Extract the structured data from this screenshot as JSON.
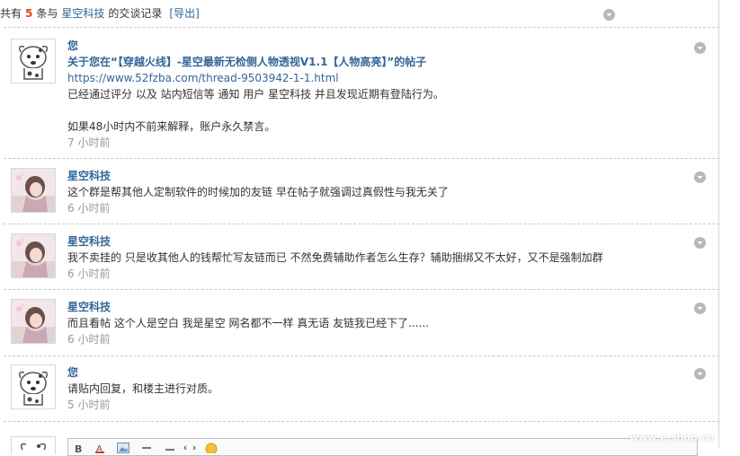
{
  "header": {
    "prefix": "共有",
    "count": "5",
    "middle": "条与",
    "partner": "星空科技",
    "suffix": "的交谈记录",
    "export_label": "[导出]"
  },
  "messages": [
    {
      "sender": "您",
      "avatar": "cartoon-dog-icon",
      "subject": "关于您在“【穿越火线】-星空最新无检侧人物透视V1.1【人物高亮】”的帖子",
      "url": "https://www.52fzba.com/thread-9503942-1-1.html",
      "line1": "已经通过评分 以及 站内短信等 通知 用户 星空科技 并且发现近期有登陆行为。",
      "line2": "如果48小时内不前来解释，账户永久禁言。",
      "time": "7 小时前"
    },
    {
      "sender": "星空科技",
      "avatar": "girl-photo-avatar",
      "text": "这个群是帮其他人定制软件的时候加的友链 早在帖子就强调过真假性与我无关了",
      "time": "6 小时前"
    },
    {
      "sender": "星空科技",
      "avatar": "girl-photo-avatar",
      "text": "我不卖挂的 只是收其他人的钱帮忙写友链而已 不然免费辅助作者怎么生存？辅助捆绑又不太好，又不是强制加群",
      "time": "6 小时前"
    },
    {
      "sender": "星空科技",
      "avatar": "girl-photo-avatar",
      "text": "而且看帖 这个人是空白 我是星空 网名都不一样 真无语 友链我已经下了......",
      "time": "6 小时前"
    },
    {
      "sender": "您",
      "avatar": "cartoon-dog-icon",
      "text": "请贴内回复，和楼主进行对质。",
      "time": "5 小时前"
    }
  ],
  "watermark": "www.e-shop.cn",
  "colors": {
    "link": "#336699",
    "count": "#e0421c",
    "muted": "#999999"
  }
}
